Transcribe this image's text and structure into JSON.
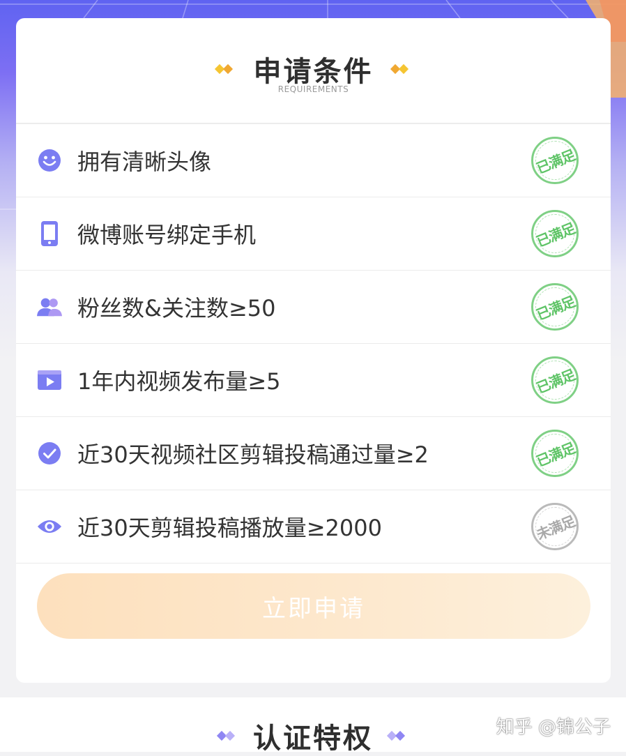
{
  "colors": {
    "accent_purple": "#7b7df2",
    "stamp_ok": "#5fc467",
    "stamp_no": "#a9a9a9",
    "diamond_gold_a": "#f5c532",
    "diamond_gold_b": "#f0a832",
    "diamond_purple_a": "#8f86f3",
    "diamond_purple_b": "#b9b0f8"
  },
  "requirements": {
    "title": "申请条件",
    "subtitle": "REQUIREMENTS",
    "items": [
      {
        "icon": "smiley-face-icon",
        "label": "拥有清晰头像",
        "status": "已满足",
        "met": true
      },
      {
        "icon": "phone-icon",
        "label": "微博账号绑定手机",
        "status": "已满足",
        "met": true
      },
      {
        "icon": "users-icon",
        "label": "粉丝数&关注数≥50",
        "status": "已满足",
        "met": true
      },
      {
        "icon": "video-play-icon",
        "label": "1年内视频发布量≥5",
        "status": "已满足",
        "met": true
      },
      {
        "icon": "check-circle-icon",
        "label": "近30天视频社区剪辑投稿通过量≥2",
        "status": "已满足",
        "met": true
      },
      {
        "icon": "eye-icon",
        "label": "近30天剪辑投稿播放量≥2000",
        "status": "未满足",
        "met": false
      }
    ],
    "apply_button": "立即申请"
  },
  "privileges": {
    "title": "认证特权"
  },
  "watermark": "知乎 @锦公子"
}
